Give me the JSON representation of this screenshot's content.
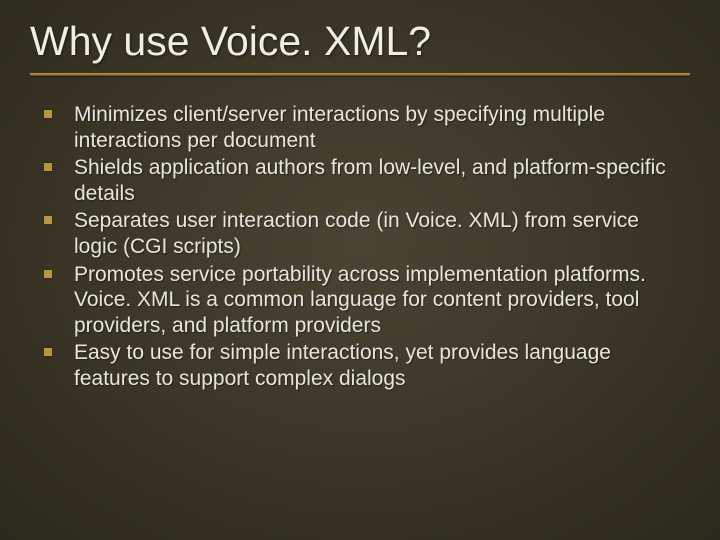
{
  "slide": {
    "title": "Why use Voice. XML?",
    "bullets": [
      "Minimizes client/server interactions by specifying multiple interactions per document",
      "Shields application authors from low-level, and platform-specific details",
      "Separates user interaction code (in Voice. XML) from service logic (CGI scripts)",
      "Promotes service portability across implementation platforms. Voice. XML is a common language for content providers, tool providers, and platform providers",
      "Easy to use for simple interactions, yet provides language features to support complex dialogs"
    ]
  }
}
